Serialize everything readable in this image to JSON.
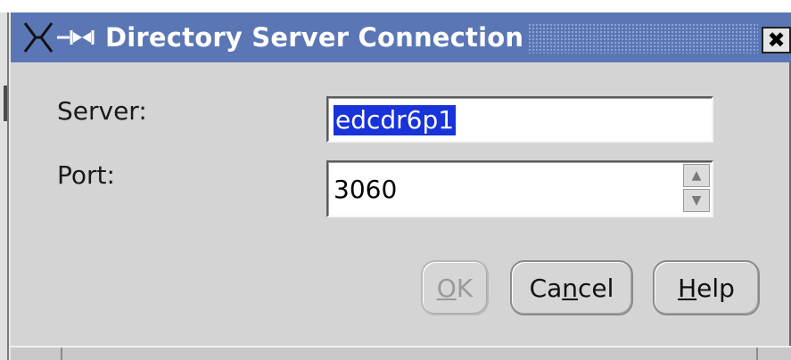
{
  "window": {
    "title": "Directory Server Connection",
    "close_glyph": "✖",
    "colors": {
      "titlebar": "#5a76b4",
      "selection": "#1733d9",
      "background": "#d4d4d4"
    }
  },
  "form": {
    "server_label": "Server:",
    "server_value": "edcdr6p1",
    "port_label": "Port:",
    "port_value": "3060",
    "spin_up_glyph": "▲",
    "spin_down_glyph": "▼"
  },
  "buttons": {
    "ok": {
      "mnemonic": "O",
      "rest": "K",
      "enabled": false
    },
    "cancel": {
      "pre": "Ca",
      "mnemonic": "n",
      "rest": "cel"
    },
    "help": {
      "mnemonic": "H",
      "rest": "elp"
    }
  }
}
